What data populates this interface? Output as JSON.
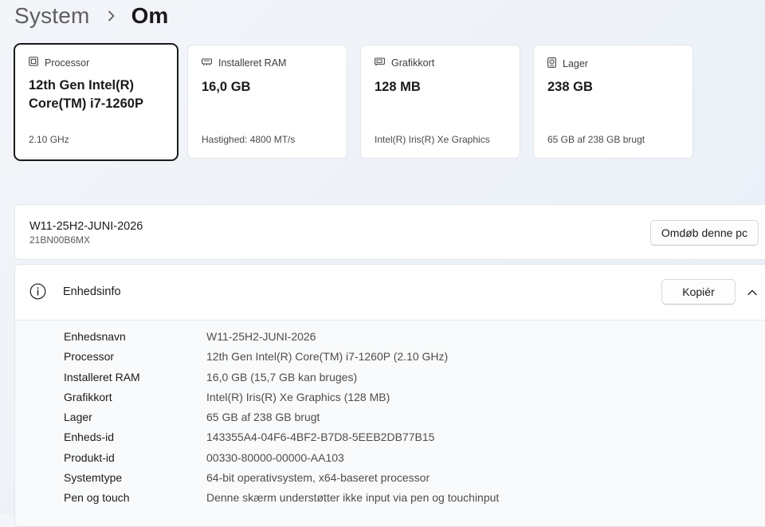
{
  "breadcrumb": {
    "parent": "System",
    "current": "Om"
  },
  "cards": [
    {
      "icon": "cpu-icon",
      "label": "Processor",
      "value": "12th Gen Intel(R) Core(TM) i7-1260P",
      "sub": "2.10 GHz"
    },
    {
      "icon": "ram-icon",
      "label": "Installeret RAM",
      "value": "16,0 GB",
      "sub": "Hastighed: 4800 MT/s"
    },
    {
      "icon": "gpu-icon",
      "label": "Grafikkort",
      "value": "128 MB",
      "sub": "Intel(R) Iris(R) Xe Graphics"
    },
    {
      "icon": "storage-icon",
      "label": "Lager",
      "value": "238 GB",
      "sub": "65 GB af 238 GB brugt"
    }
  ],
  "device": {
    "name": "W11-25H2-JUNI-2026",
    "model": "21BN00B6MX",
    "rename_label": "Omdøb denne pc"
  },
  "device_info": {
    "title": "Enhedsinfo",
    "copy_label": "Kopiér",
    "rows": [
      {
        "label": "Enhedsnavn",
        "value": "W11-25H2-JUNI-2026"
      },
      {
        "label": "Processor",
        "value": "12th Gen Intel(R) Core(TM) i7-1260P (2.10 GHz)"
      },
      {
        "label": "Installeret RAM",
        "value": "16,0 GB (15,7 GB kan bruges)"
      },
      {
        "label": "Grafikkort",
        "value": "Intel(R) Iris(R) Xe Graphics (128 MB)"
      },
      {
        "label": "Lager",
        "value": "65 GB af 238 GB brugt"
      },
      {
        "label": "Enheds-id",
        "value": "143355A4-04F6-4BF2-B7D8-5EEB2DB77B15"
      },
      {
        "label": "Produkt-id",
        "value": "00330-80000-00000-AA103"
      },
      {
        "label": "Systemtype",
        "value": "64-bit operativsystem, x64-baseret processor"
      },
      {
        "label": "Pen og touch",
        "value": "Denne skærm understøtter ikke input via pen og touchinput"
      }
    ]
  }
}
